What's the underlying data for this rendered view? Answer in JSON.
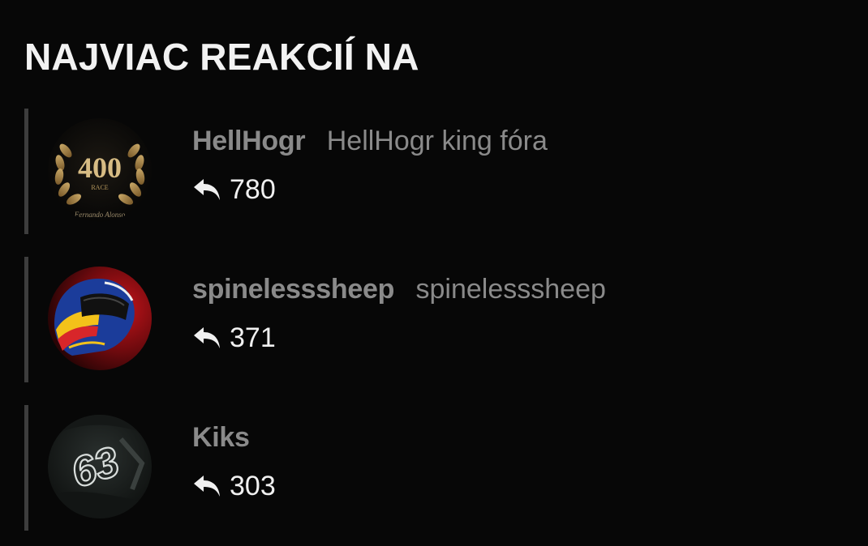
{
  "section": {
    "title": "NAJVIAC REAKCIÍ NA"
  },
  "users": [
    {
      "username": "HellHogr",
      "user_title": "HellHogr king fóra",
      "reactions": "780",
      "avatar": "laurel-400-race-avatar",
      "avatar_text": "400",
      "avatar_subtext": "RACE",
      "avatar_signature": "Fernando Alonso"
    },
    {
      "username": "spinelesssheep",
      "user_title": "spinelesssheep",
      "reactions": "371",
      "avatar": "racing-helmet-avatar"
    },
    {
      "username": "Kiks",
      "user_title": "",
      "reactions": "303",
      "avatar": "number-63-avatar",
      "avatar_text": "63"
    }
  ],
  "icons": {
    "reply": "reply-arrow-icon"
  },
  "colors": {
    "background": "#070707",
    "title": "#f2f2f2",
    "username": "#8a8a8a",
    "count": "#f0f0f0",
    "divider": "#3d3d3d"
  }
}
